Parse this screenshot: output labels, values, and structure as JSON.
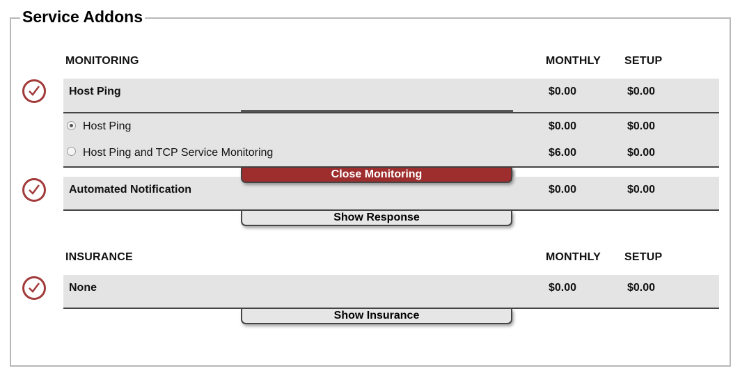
{
  "legend": "Service Addons",
  "monitoring": {
    "header": "MONITORING",
    "monthly_header": "MONTHLY",
    "setup_header": "SETUP",
    "selected": {
      "label": "Host Ping",
      "monthly": "$0.00",
      "setup": "$0.00"
    },
    "options": [
      {
        "label": "Host Ping",
        "monthly": "$0.00",
        "setup": "$0.00",
        "checked": true
      },
      {
        "label": "Host Ping and TCP Service Monitoring",
        "monthly": "$6.00",
        "setup": "$0.00",
        "checked": false
      }
    ],
    "toggle_label": "Close Monitoring"
  },
  "notification": {
    "label": "Automated Notification",
    "monthly": "$0.00",
    "setup": "$0.00",
    "toggle_label": "Show Response"
  },
  "insurance": {
    "header": "INSURANCE",
    "monthly_header": "MONTHLY",
    "setup_header": "SETUP",
    "selected": {
      "label": "None",
      "monthly": "$0.00",
      "setup": "$0.00"
    },
    "toggle_label": "Show Insurance"
  },
  "colors": {
    "accent": "#9e2d2d",
    "row_bg": "#e4e4e4"
  }
}
